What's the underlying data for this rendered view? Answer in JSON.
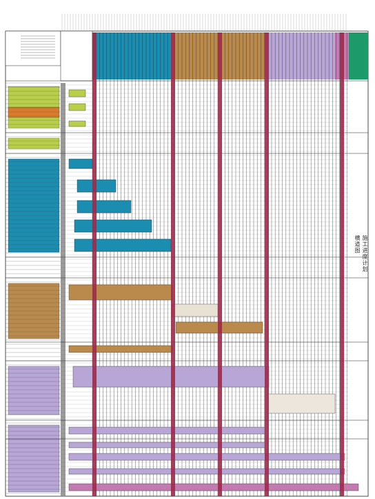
{
  "document": {
    "type": "gantt-schedule-sheet",
    "side_label": "施工进度计划横道图"
  },
  "colors": {
    "grid": "#222222",
    "phase_green": "#b9cf4a",
    "phase_orange": "#d97b2b",
    "phase_teal": "#1b8db0",
    "phase_brown": "#b98a4c",
    "phase_lavender": "#b7a6d6",
    "phase_pink": "#c27ab0",
    "milestone_red": "#9c2a4a",
    "legend_green": "#1c9a6a",
    "grey_bar": "#9a9a9a"
  },
  "rows": {
    "groups": [
      {
        "name": "group-1",
        "color": "phase_green"
      },
      {
        "name": "group-2",
        "color": "phase_orange"
      },
      {
        "name": "group-3",
        "color": "phase_teal"
      },
      {
        "name": "group-4",
        "color": "phase_brown"
      },
      {
        "name": "group-5",
        "color": "phase_lavender"
      },
      {
        "name": "group-6",
        "color": "phase_pink"
      }
    ]
  }
}
